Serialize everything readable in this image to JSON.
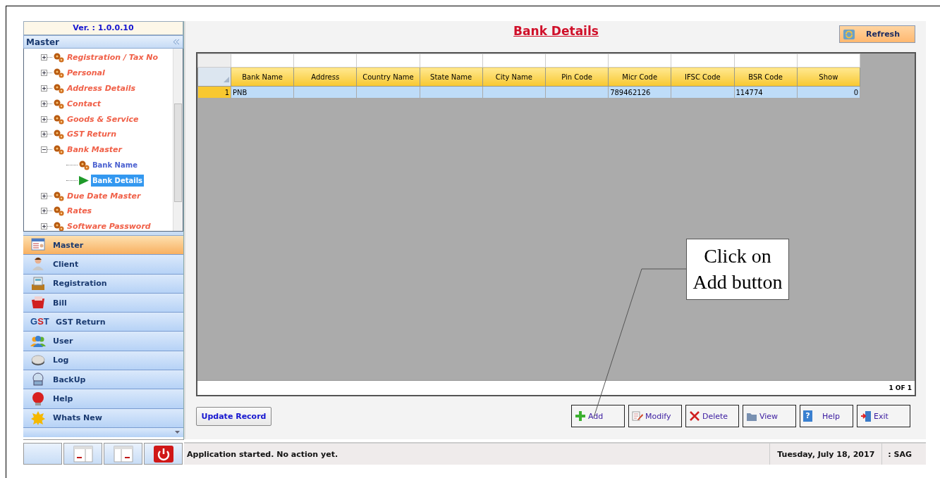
{
  "sidebar": {
    "version": "Ver. : 1.0.0.10",
    "panel_title": "Master",
    "tree": [
      {
        "label": "Registration / Tax No",
        "expanded": false
      },
      {
        "label": "Personal",
        "expanded": false
      },
      {
        "label": "Address Details",
        "expanded": false
      },
      {
        "label": "Contact",
        "expanded": false
      },
      {
        "label": "Goods & Service",
        "expanded": false
      },
      {
        "label": "GST Return",
        "expanded": false
      },
      {
        "label": "Bank Master",
        "expanded": true,
        "children": [
          {
            "label": "Bank Name",
            "selected": false
          },
          {
            "label": "Bank Details",
            "selected": true
          }
        ]
      },
      {
        "label": "Due Date Master",
        "expanded": false
      },
      {
        "label": "Rates",
        "expanded": false
      },
      {
        "label": "Software Password",
        "expanded": false
      }
    ],
    "nav": [
      {
        "label": "Master",
        "selected": true
      },
      {
        "label": "Client",
        "selected": false
      },
      {
        "label": "Registration",
        "selected": false
      },
      {
        "label": "Bill",
        "selected": false
      },
      {
        "label": "GST Return",
        "selected": false,
        "icon_text": "GST"
      },
      {
        "label": "User",
        "selected": false
      },
      {
        "label": "Log",
        "selected": false
      },
      {
        "label": "BackUp",
        "selected": false
      },
      {
        "label": "Help",
        "selected": false
      },
      {
        "label": "Whats New",
        "selected": false
      }
    ]
  },
  "main": {
    "title": "Bank Details",
    "refresh_button": "Refresh",
    "table": {
      "columns": [
        "Bank Name",
        "Address",
        "Country Name",
        "State Name",
        "City Name",
        "Pin Code",
        "Micr Code",
        "IFSC Code",
        "BSR Code",
        "Show"
      ],
      "rows": [
        {
          "number": "1",
          "selected": true,
          "cells": [
            "PNB",
            "",
            "",
            "",
            "",
            "",
            "789462126",
            "",
            "114774",
            "0"
          ]
        }
      ],
      "pager": "1 OF 1"
    },
    "update_button": "Update Record",
    "buttons": [
      {
        "label": "Add"
      },
      {
        "label": "Modify"
      },
      {
        "label": "Delete"
      },
      {
        "label": "View"
      },
      {
        "label": "Help",
        "icon_text": "?"
      },
      {
        "label": "Exit"
      }
    ],
    "callout": "Click on Add button"
  },
  "status_bar": {
    "message": "Application started. No action yet.",
    "date": "Tuesday, July 18, 2017",
    "user": ": SAG"
  }
}
